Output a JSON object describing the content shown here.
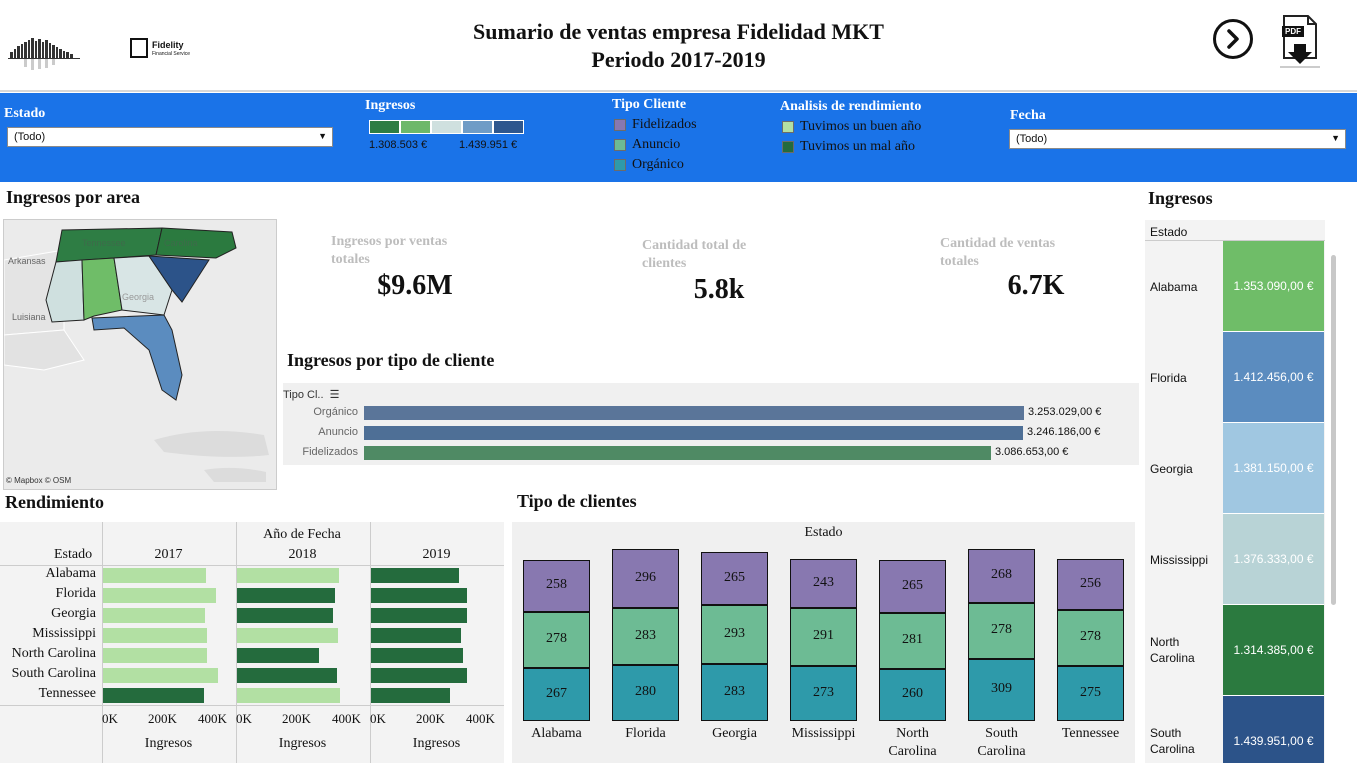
{
  "header": {
    "title_line1": "Sumario de ventas empresa Fidelidad MKT",
    "title_line2": "Periodo 2017-2019",
    "logo2_name": "Fidelity",
    "logo2_sub": "Financial Service",
    "pdf_label": "PDF"
  },
  "filters": {
    "estado": {
      "label": "Estado",
      "value": "(Todo)"
    },
    "ingresos": {
      "label": "Ingresos",
      "min": "1.308.503 €",
      "max": "1.439.951 €",
      "colors": [
        "#2e7d44",
        "#6db86a",
        "#cfe0df",
        "#6f9cc6",
        "#2e578e"
      ]
    },
    "tipo_cliente": {
      "label": "Tipo Cliente",
      "items": [
        {
          "name": "Fidelizados",
          "color": "#8878b0"
        },
        {
          "name": "Anuncio",
          "color": "#6dbb94"
        },
        {
          "name": "Orgánico",
          "color": "#2e9aaa"
        }
      ]
    },
    "rendimiento": {
      "label": "Analisis de rendimiento",
      "items": [
        {
          "name": "Tuvimos un buen año",
          "color": "#b2e0a3"
        },
        {
          "name": "Tuvimos un mal año",
          "color": "#246b3d"
        }
      ]
    },
    "fecha": {
      "label": "Fecha",
      "value": "(Todo)"
    }
  },
  "map": {
    "title": "Ingresos por area",
    "labels": [
      "Arkansas",
      "Tennessee",
      "Carolina",
      "Georgia",
      "Luisiana"
    ],
    "credit": "© Mapbox © OSM"
  },
  "kpis": [
    {
      "label_line1": "Ingresos por ventas",
      "label_line2": "totales",
      "value": "$9.6M"
    },
    {
      "label_line1": "Cantidad total de",
      "label_line2": "clientes",
      "value": "5.8k"
    },
    {
      "label_line1": "Cantidad de ventas",
      "label_line2": "totales",
      "value": "6.7K"
    }
  ],
  "tipo_bar": {
    "title": "Ingresos por tipo de cliente",
    "header": "Tipo Cl..",
    "chart_data": {
      "type": "bar",
      "categories": [
        "Orgánico",
        "Anuncio",
        "Fidelizados"
      ],
      "values": [
        3253029,
        3246186,
        3086653
      ],
      "labels": [
        "3.253.029,00 €",
        "3.246.186,00 €",
        "3.086.653,00 €"
      ],
      "colors": [
        "#5a7599",
        "#4e6f96",
        "#4f8a64"
      ]
    }
  },
  "rendimiento": {
    "title": "Rendimiento",
    "col_header": "Año de Fecha",
    "row_header": "Estado",
    "years": [
      "2017",
      "2018",
      "2019"
    ],
    "states": [
      "Alabama",
      "Florida",
      "Georgia",
      "Mississippi",
      "North Carolina",
      "South Carolina",
      "Tennessee"
    ],
    "ticks": [
      "0K",
      "200K",
      "400K"
    ],
    "axis_label": "Ingresos",
    "max": 500000,
    "good_color": "#b2e0a3",
    "bad_color": "#246b3d",
    "chart_data": {
      "type": "bar",
      "series": [
        {
          "name": "2017",
          "values": [
            430000,
            470000,
            425000,
            435000,
            435000,
            480000,
            420000
          ],
          "good": [
            true,
            true,
            true,
            true,
            true,
            true,
            false
          ]
        },
        {
          "name": "2018",
          "values": [
            425000,
            410000,
            400000,
            420000,
            340000,
            415000,
            430000
          ],
          "good": [
            true,
            false,
            false,
            true,
            false,
            false,
            true
          ]
        },
        {
          "name": "2019",
          "values": [
            365000,
            400000,
            400000,
            375000,
            385000,
            400000,
            330000
          ],
          "good": [
            false,
            false,
            false,
            false,
            false,
            false,
            false
          ]
        }
      ]
    }
  },
  "tipo_clientes": {
    "title": "Tipo de clientes",
    "top_label": "Estado",
    "chart_data": {
      "type": "bar",
      "categories": [
        "Alabama",
        "Florida",
        "Georgia",
        "Mississippi",
        "North Carolina",
        "South Carolina",
        "Tennessee"
      ],
      "series": [
        {
          "name": "Orgánico",
          "color": "#2e9aaa",
          "values": [
            267,
            280,
            283,
            273,
            260,
            309,
            275
          ]
        },
        {
          "name": "Anuncio",
          "color": "#6dbb94",
          "values": [
            278,
            283,
            293,
            291,
            281,
            278,
            278
          ]
        },
        {
          "name": "Fidelizados",
          "color": "#8878b0",
          "values": [
            258,
            296,
            265,
            243,
            265,
            268,
            256
          ]
        }
      ]
    }
  },
  "ingresos_table": {
    "title": "Ingresos",
    "header": "Estado",
    "rows": [
      {
        "state_line1": "Alabama",
        "state_line2": "",
        "value": "1.353.090,00 €",
        "color": "#6fbd68"
      },
      {
        "state_line1": "Florida",
        "state_line2": "",
        "value": "1.412.456,00 €",
        "color": "#5b8cbf"
      },
      {
        "state_line1": "Georgia",
        "state_line2": "",
        "value": "1.381.150,00 €",
        "color": "#a0c7e1"
      },
      {
        "state_line1": "Mississippi",
        "state_line2": "",
        "value": "1.376.333,00 €",
        "color": "#b8d3d6"
      },
      {
        "state_line1": "North",
        "state_line2": "Carolina",
        "value": "1.314.385,00 €",
        "color": "#2b7a3f"
      },
      {
        "state_line1": "South",
        "state_line2": "Carolina",
        "value": "1.439.951,00 €",
        "color": "#2c5389"
      }
    ]
  }
}
